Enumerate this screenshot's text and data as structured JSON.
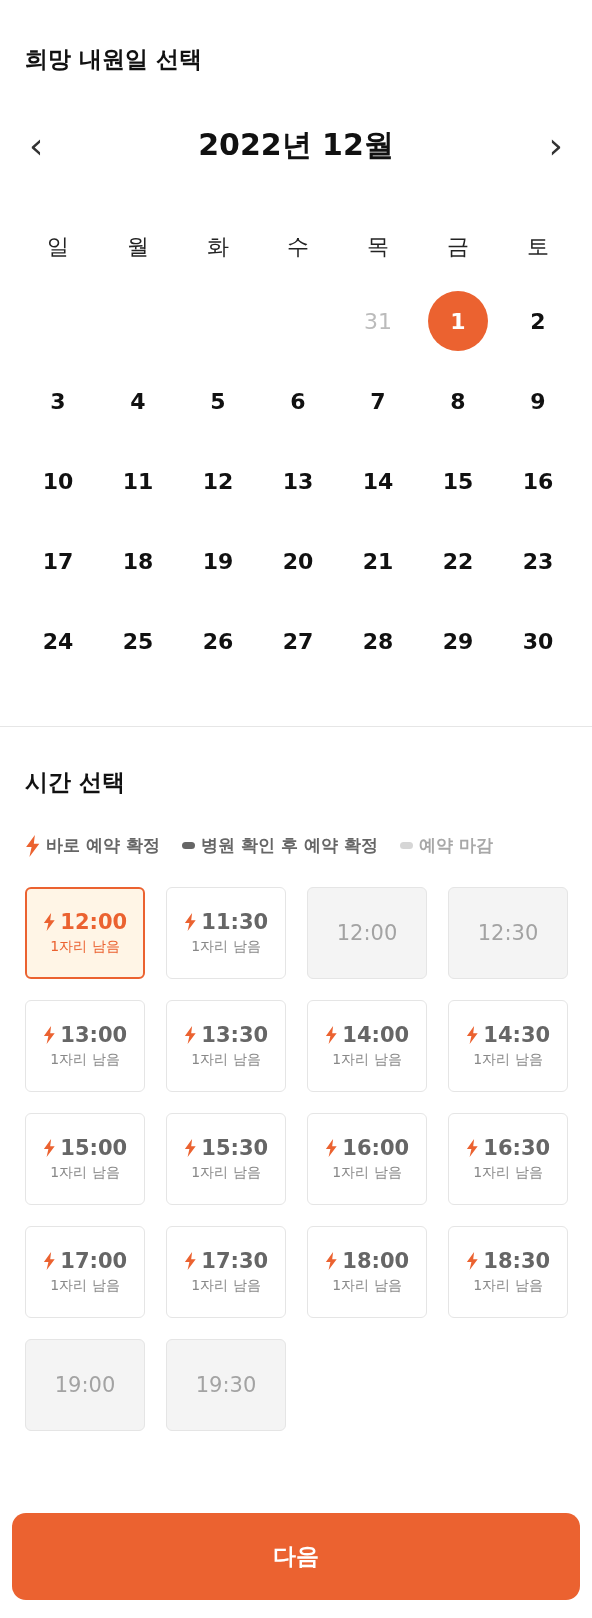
{
  "date_section": {
    "title": "희망 내원일 선택"
  },
  "calendar": {
    "prev": "‹",
    "month": "2022년 12월",
    "next": "›",
    "weekdays": [
      "일",
      "월",
      "화",
      "수",
      "목",
      "금",
      "토"
    ],
    "weeks": [
      [
        {
          "day": "31",
          "kind": "other",
          "selected": false
        },
        {
          "day": "1",
          "kind": "current",
          "selected": true
        },
        {
          "day": "2",
          "kind": "current",
          "selected": false
        }
      ],
      [
        {
          "day": "3",
          "kind": "current",
          "selected": false
        },
        {
          "day": "4",
          "kind": "current",
          "selected": false
        },
        {
          "day": "5",
          "kind": "current",
          "selected": false
        },
        {
          "day": "6",
          "kind": "current",
          "selected": false
        },
        {
          "day": "7",
          "kind": "current",
          "selected": false
        },
        {
          "day": "8",
          "kind": "current",
          "selected": false
        },
        {
          "day": "9",
          "kind": "current",
          "selected": false
        }
      ],
      [
        {
          "day": "10",
          "kind": "current",
          "selected": false
        },
        {
          "day": "11",
          "kind": "current",
          "selected": false
        },
        {
          "day": "12",
          "kind": "current",
          "selected": false
        },
        {
          "day": "13",
          "kind": "current",
          "selected": false
        },
        {
          "day": "14",
          "kind": "current",
          "selected": false
        },
        {
          "day": "15",
          "kind": "current",
          "selected": false
        },
        {
          "day": "16",
          "kind": "current",
          "selected": false
        }
      ],
      [
        {
          "day": "17",
          "kind": "current",
          "selected": false
        },
        {
          "day": "18",
          "kind": "current",
          "selected": false
        },
        {
          "day": "19",
          "kind": "current",
          "selected": false
        },
        {
          "day": "20",
          "kind": "current",
          "selected": false
        },
        {
          "day": "21",
          "kind": "current",
          "selected": false
        },
        {
          "day": "22",
          "kind": "current",
          "selected": false
        },
        {
          "day": "23",
          "kind": "current",
          "selected": false
        }
      ],
      [
        {
          "day": "24",
          "kind": "current",
          "selected": false
        },
        {
          "day": "25",
          "kind": "current",
          "selected": false
        },
        {
          "day": "26",
          "kind": "current",
          "selected": false
        },
        {
          "day": "27",
          "kind": "current",
          "selected": false
        },
        {
          "day": "28",
          "kind": "current",
          "selected": false
        },
        {
          "day": "29",
          "kind": "current",
          "selected": false
        },
        {
          "day": "30",
          "kind": "current",
          "selected": false
        }
      ]
    ]
  },
  "time_section": {
    "title": "시간 선택",
    "legend": [
      {
        "kind": "instant",
        "label": "바로 예약 확정"
      },
      {
        "kind": "confirm",
        "label": "병원 확인 후 예약 확정"
      },
      {
        "kind": "closed",
        "label": "예약 마감"
      }
    ],
    "slots": [
      {
        "time": "12:00",
        "kind": "instant",
        "remaining": "1자리 남음",
        "selected": true
      },
      {
        "time": "11:30",
        "kind": "instant",
        "remaining": "1자리 남음",
        "selected": false
      },
      {
        "time": "12:00",
        "kind": "closed",
        "selected": false
      },
      {
        "time": "12:30",
        "kind": "closed",
        "selected": false
      },
      {
        "time": "13:00",
        "kind": "instant",
        "remaining": "1자리 남음",
        "selected": false
      },
      {
        "time": "13:30",
        "kind": "instant",
        "remaining": "1자리 남음",
        "selected": false
      },
      {
        "time": "14:00",
        "kind": "instant",
        "remaining": "1자리 남음",
        "selected": false
      },
      {
        "time": "14:30",
        "kind": "instant",
        "remaining": "1자리 남음",
        "selected": false
      },
      {
        "time": "15:00",
        "kind": "instant",
        "remaining": "1자리 남음",
        "selected": false
      },
      {
        "time": "15:30",
        "kind": "instant",
        "remaining": "1자리 남음",
        "selected": false
      },
      {
        "time": "16:00",
        "kind": "instant",
        "remaining": "1자리 남음",
        "selected": false
      },
      {
        "time": "16:30",
        "kind": "instant",
        "remaining": "1자리 남음",
        "selected": false
      },
      {
        "time": "17:00",
        "kind": "instant",
        "remaining": "1자리 남음",
        "selected": false
      },
      {
        "time": "17:30",
        "kind": "instant",
        "remaining": "1자리 남음",
        "selected": false
      },
      {
        "time": "18:00",
        "kind": "instant",
        "remaining": "1자리 남음",
        "selected": false
      },
      {
        "time": "18:30",
        "kind": "instant",
        "remaining": "1자리 남음",
        "selected": false
      },
      {
        "time": "19:00",
        "kind": "closed",
        "selected": false
      },
      {
        "time": "19:30",
        "kind": "closed",
        "selected": false
      }
    ]
  },
  "next_button": "다음"
}
